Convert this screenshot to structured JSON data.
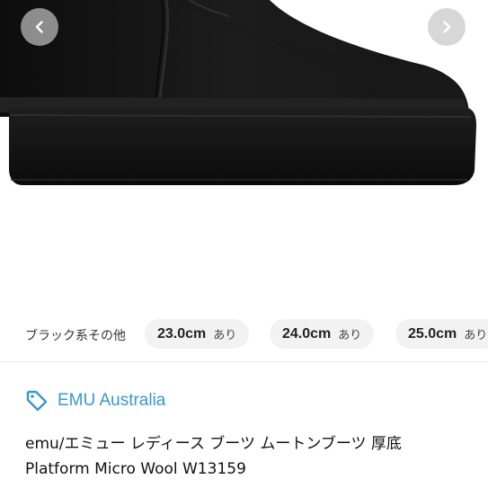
{
  "gallery": {
    "prev_icon": "chevron-left-icon",
    "next_icon": "chevron-right-icon"
  },
  "variants": {
    "color": "ブラック系その他",
    "sizes": [
      {
        "size": "23.0cm",
        "stock": "あり"
      },
      {
        "size": "24.0cm",
        "stock": "あり"
      },
      {
        "size": "25.0cm",
        "stock": "あり"
      }
    ]
  },
  "brand": {
    "icon": "tag-icon",
    "name": "EMU Australia",
    "color": "#3a96cf"
  },
  "product": {
    "title_line1": "emu/エミュー レディース ブーツ ムートンブーツ 厚底",
    "title_line2": "Platform Micro Wool W13159"
  }
}
